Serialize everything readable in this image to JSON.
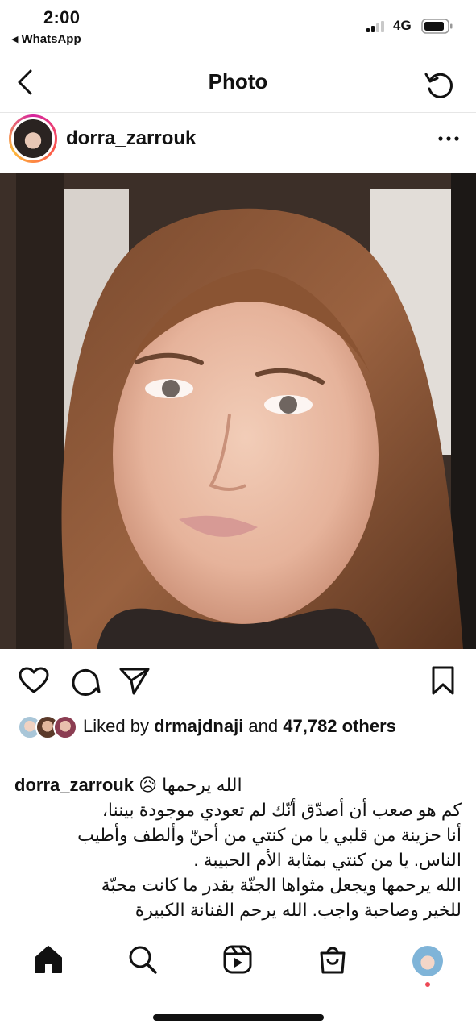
{
  "status_bar": {
    "time": "2:00",
    "back_app": "WhatsApp",
    "network": "4G"
  },
  "nav": {
    "title": "Photo",
    "back_icon": "chevron-left-icon",
    "refresh_icon": "refresh-icon"
  },
  "post": {
    "username": "dorra_zarrouk",
    "likes": {
      "prefix": "Liked by ",
      "user": "drmajdnaji",
      "middle": " and ",
      "count": "47,782",
      "suffix": " others"
    },
    "caption": {
      "username": "dorra_zarrouk",
      "first_line": "الله يرحمها 😥",
      "lines": [
        "كم هو صعب أن أصدّق أنّك لم تعودي موجودة بيننا،",
        "أنا حزينة من قلبي يا من كنتي من أحنّ وألطف وأطيب",
        "الناس. يا من كنتي بمثابة الأم الحبيبة .",
        "الله يرحمها ويجعل مثواها الجنّة بقدر ما كانت محبّة",
        "للخير وصاحبة واجب. الله يرحم الفنانة الكبيرة"
      ]
    }
  },
  "colors": {
    "text": "#111111",
    "divider": "#e6e6e6",
    "notification": "#ed4956"
  }
}
